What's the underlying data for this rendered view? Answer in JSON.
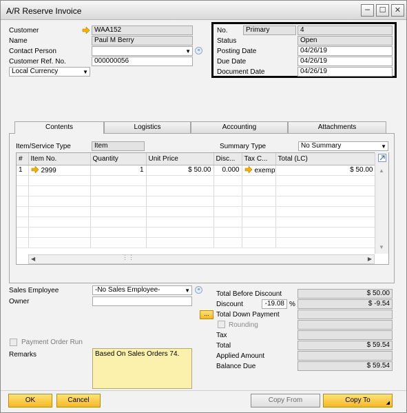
{
  "window": {
    "title": "A/R Reserve Invoice"
  },
  "header": {
    "customer_label": "Customer",
    "customer_value": "WAA152",
    "name_label": "Name",
    "name_value": "Paul M  Berry",
    "contact_label": "Contact Person",
    "contact_value": "",
    "ref_label": "Customer Ref. No.",
    "ref_value": "000000056",
    "currency_value": "Local Currency"
  },
  "document": {
    "no_label": "No.",
    "series_value": "Primary",
    "no_value": "4",
    "status_label": "Status",
    "status_value": "Open",
    "posting_label": "Posting Date",
    "posting_value": "04/26/19",
    "due_label": "Due Date",
    "due_value": "04/26/19",
    "docdate_label": "Document Date",
    "docdate_value": "04/26/19"
  },
  "tabs": [
    {
      "label": "Contents"
    },
    {
      "label": "Logistics"
    },
    {
      "label": "Accounting"
    },
    {
      "label": "Attachments"
    }
  ],
  "contents": {
    "item_type_label": "Item/Service Type",
    "item_type_value": "Item",
    "summary_label": "Summary Type",
    "summary_value": "No Summary",
    "columns": [
      "#",
      "Item No.",
      "Quantity",
      "Unit Price",
      "Disc...",
      "Tax C...",
      "Total (LC)"
    ],
    "rows": [
      {
        "num": "1",
        "item": "2999",
        "qty": "1",
        "price": "$ 50.00",
        "disc": "0.000",
        "tax": "exempt",
        "total": "$ 50.00"
      }
    ]
  },
  "footer": {
    "sales_employee_label": "Sales Employee",
    "sales_employee_value": "-No Sales Employee-",
    "owner_label": "Owner",
    "owner_value": "",
    "payment_order_label": "Payment Order Run",
    "remarks_label": "Remarks",
    "remarks_value": "Based On Sales Orders 74.",
    "total_before_label": "Total Before Discount",
    "total_before_value": "$ 50.00",
    "discount_label": "Discount",
    "discount_pct": "-19.08",
    "pct_sign": "%",
    "discount_value": "$ -9.54",
    "down_payment_label": "Total Down Payment",
    "down_payment_btn": "...",
    "rounding_label": "Rounding",
    "tax_label": "Tax",
    "tax_value": "",
    "total_label": "Total",
    "total_value": "$ 59.54",
    "applied_label": "Applied Amount",
    "applied_value": "",
    "balance_label": "Balance Due",
    "balance_value": "$ 59.54"
  },
  "buttons": {
    "ok": "OK",
    "cancel": "Cancel",
    "copy_from": "Copy From",
    "copy_to": "Copy To"
  },
  "colors": {
    "accent_yellow": "#f6b922",
    "remarks_bg": "#fcf0ad",
    "link_arrow": "#f2b300"
  }
}
